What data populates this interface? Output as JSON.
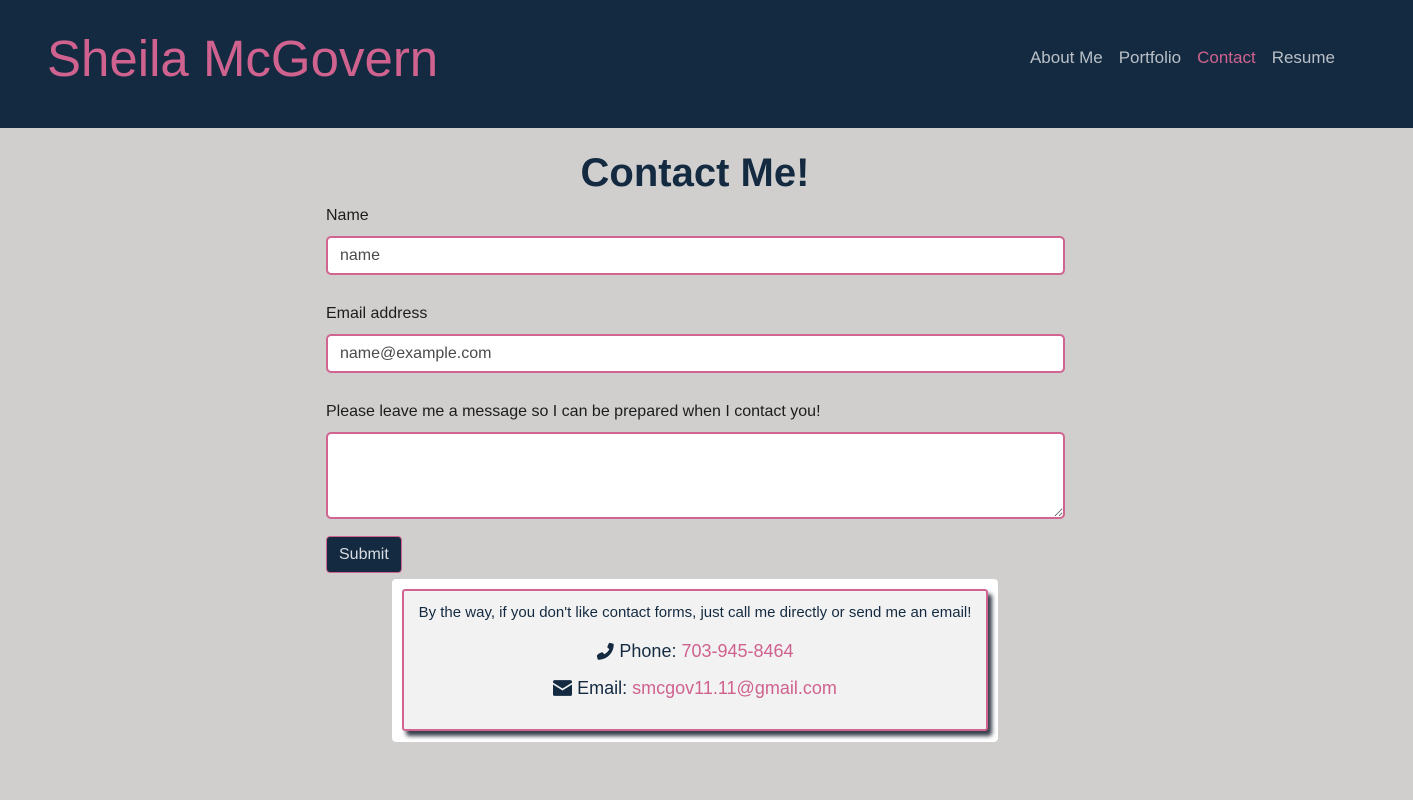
{
  "header": {
    "brand": "Sheila McGovern",
    "nav": [
      {
        "label": "About Me",
        "active": false
      },
      {
        "label": "Portfolio",
        "active": false
      },
      {
        "label": "Contact",
        "active": true
      },
      {
        "label": "Resume",
        "active": false
      }
    ]
  },
  "main": {
    "title": "Contact Me!",
    "form": {
      "name_label": "Name",
      "name_placeholder": "name",
      "email_label": "Email address",
      "email_placeholder": "name@example.com",
      "message_label": "Please leave me a message so I can be prepared when I contact you!",
      "message_value": "",
      "submit_label": "Submit"
    },
    "contact_card": {
      "intro": "By the way, if you don't like contact forms, just call me directly or send me an email!",
      "phone_label": "Phone:",
      "phone_value": "703-945-8464",
      "phone_icon": "phone-icon",
      "email_label": "Email:",
      "email_value": "smcgov11.11@gmail.com",
      "email_icon": "envelope-icon"
    }
  },
  "colors": {
    "navbar_bg": "#142a40",
    "accent_pink": "#d0628f",
    "page_bg": "#d0cfce",
    "nav_text": "#b9bfc7"
  }
}
